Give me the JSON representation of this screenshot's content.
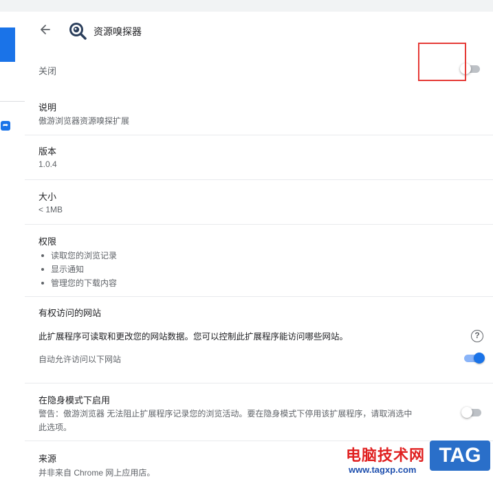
{
  "header": {
    "title": "资源嗅探器"
  },
  "enable_row": {
    "label": "关闭",
    "toggle_on": false
  },
  "description": {
    "label": "说明",
    "value": "傲游浏览器资源嗅探扩展"
  },
  "version": {
    "label": "版本",
    "value": "1.0.4"
  },
  "size": {
    "label": "大小",
    "value": "< 1MB"
  },
  "permissions": {
    "label": "权限",
    "items": [
      "读取您的浏览记录",
      "显示通知",
      "管理您的下载内容"
    ]
  },
  "site_access": {
    "label": "有权访问的网站",
    "description": "此扩展程序可读取和更改您的网站数据。您可以控制此扩展程序能访问哪些网站。",
    "auto_allow_label": "自动允许访问以下网站",
    "auto_allow_on": true
  },
  "incognito": {
    "label": "在隐身模式下启用",
    "warning_line1": "警告：傲游浏览器 无法阻止扩展程序记录您的浏览活动。要在隐身模式下停用该扩展程序，请取消选中",
    "warning_line2": "此选项。",
    "toggle_on": false
  },
  "source": {
    "label": "来源",
    "value": "并非来自 Chrome 网上应用店。"
  },
  "watermark": {
    "site_name": "电脑技术网",
    "url": "www.tagxp.com",
    "tag": "TAG"
  },
  "colors": {
    "accent": "#1a73e8",
    "highlight": "#e53935"
  }
}
